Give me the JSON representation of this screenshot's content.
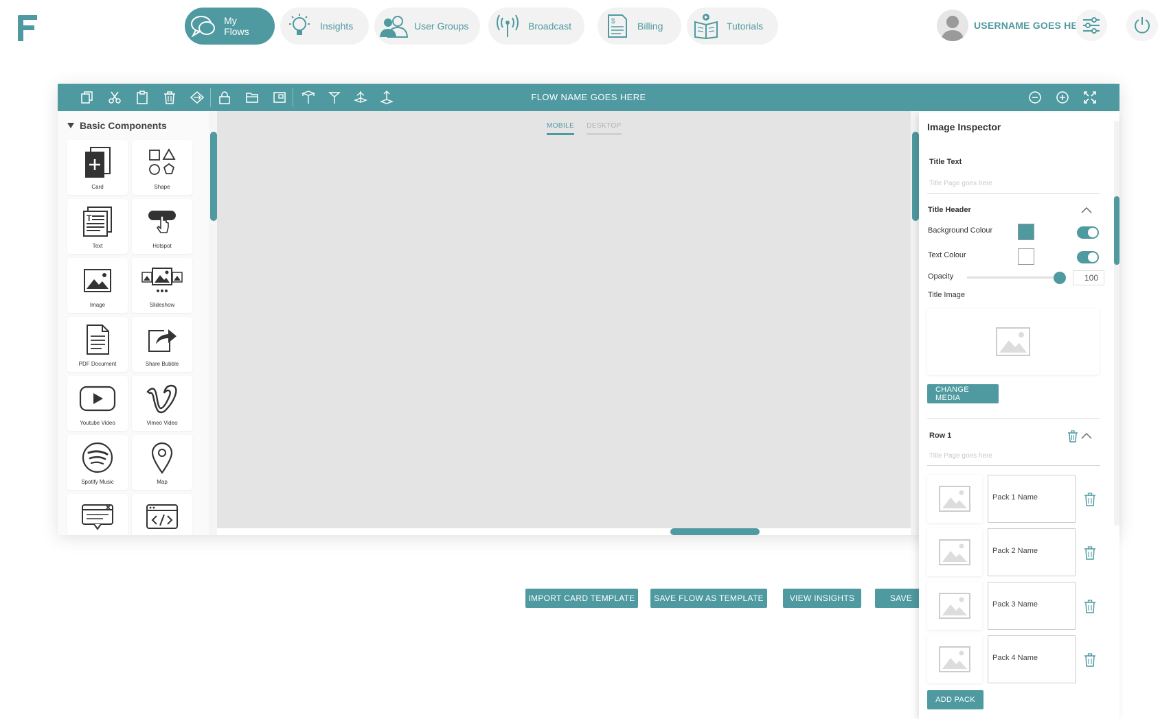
{
  "nav": {
    "logo": "F",
    "items": [
      {
        "label": "My Flows",
        "icon": "chat-bubbles-icon",
        "active": true
      },
      {
        "label": "Insights",
        "icon": "lightbulb-icon",
        "active": false
      },
      {
        "label": "User Groups",
        "icon": "users-icon",
        "active": false
      },
      {
        "label": "Broadcast",
        "icon": "broadcast-antenna-icon",
        "active": false
      },
      {
        "label": "Billing",
        "icon": "invoice-icon",
        "active": false
      },
      {
        "label": "Tutorials",
        "icon": "book-play-icon",
        "active": false
      }
    ],
    "username": "USERNAME GOES HERE",
    "settings_icon": "sliders-icon",
    "power_icon": "power-icon"
  },
  "editor": {
    "flow_name": "FLOW NAME GOES HERE",
    "toolbar_icons": [
      "copy-icon",
      "cut-icon",
      "paste-icon",
      "trash-icon",
      "diamond-arrows-icon",
      "lock-icon",
      "folder-icon",
      "layout-icon",
      "align-top-icon",
      "align-middle-icon",
      "align-center-icon",
      "align-bottom-icon"
    ],
    "zoom_icons": [
      "zoom-out-icon",
      "zoom-in-icon",
      "fit-screen-icon"
    ],
    "tabs": {
      "mobile": "MOBILE",
      "desktop": "DESKTOP"
    }
  },
  "palette": {
    "heading": "Basic Components",
    "items": [
      {
        "label": "Card",
        "icon": "card-icon"
      },
      {
        "label": "Shape",
        "icon": "shapes-icon"
      },
      {
        "label": "Text",
        "icon": "text-icon"
      },
      {
        "label": "Hotspot",
        "icon": "hotspot-icon"
      },
      {
        "label": "Image",
        "icon": "image-icon"
      },
      {
        "label": "Slideshow",
        "icon": "slideshow-icon"
      },
      {
        "label": "PDF Document",
        "icon": "pdf-icon"
      },
      {
        "label": "Share Bubble",
        "icon": "share-icon"
      },
      {
        "label": "Youtube Video",
        "icon": "youtube-icon"
      },
      {
        "label": "Vimeo Video",
        "icon": "vimeo-icon"
      },
      {
        "label": "Spotify Music",
        "icon": "spotify-icon"
      },
      {
        "label": "Map",
        "icon": "map-pin-icon"
      },
      {
        "label": "",
        "icon": "popup-icon"
      },
      {
        "label": "",
        "icon": "code-icon"
      }
    ]
  },
  "inspector": {
    "title": "Image Inspector",
    "title_text_label": "Title Text",
    "title_text_placeholder": "Title Page goes here",
    "title_header_label": "Title Header",
    "background_colour_label": "Background Colour",
    "background_colour": "#4f9aa0",
    "text_colour_label": "Text Colour",
    "text_colour": "#ffffff",
    "opacity_label": "Opacity",
    "opacity_value": "100",
    "title_image_label": "Title Image",
    "change_media": "CHANGE MEDIA",
    "row_label": "Row 1",
    "row_placeholder": "Title Page goes here",
    "packs": [
      "Pack 1 Name",
      "Pack 2 Name",
      "Pack 3 Name",
      "Pack 4 Name"
    ],
    "add_pack": "ADD PACK"
  },
  "actions": {
    "import_card_template": "IMPORT CARD TEMPLATE",
    "save_flow_as_template": "SAVE FLOW AS TEMPLATE",
    "view_insights": "VIEW INSIGHTS",
    "save": "SAVE"
  },
  "colors": {
    "accent": "#4f9aa0",
    "canvas": "#e4e4e4"
  }
}
